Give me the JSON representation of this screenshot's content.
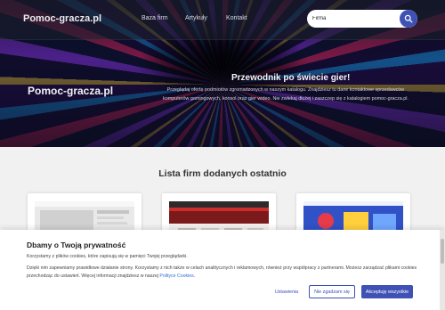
{
  "nav": {
    "brand": "Pomoc-gracza.pl",
    "links": [
      "Baza firm",
      "Artykuły",
      "Kontakt"
    ],
    "search": {
      "value": "Firma",
      "placeholder": "Firma"
    }
  },
  "hero": {
    "brand": "Pomoc-gracza.pl",
    "title": "Przewodnik po świecie gier!",
    "description": "Przeglądaj ofertę podmiotów zgromadzonych w naszym katalogu. Znajdziesz tu dane kontaktowe sprzedawców komputerów gamingowych, konsol oraz gier wideo. Nie zwlekaj dłużej i zaszczep się z katalogiem pomoc-gracza.pl."
  },
  "section": {
    "title": "Lista firm dodanych ostatnio",
    "cards": [
      {
        "name": "card-1"
      },
      {
        "name": "card-2"
      },
      {
        "name": "card-3"
      }
    ]
  },
  "cookie": {
    "title": "Dbamy o Twoją prywatność",
    "line1": "Korzystamy z plików cookies, które zapisują się w pamięci Twojej przeglądarki.",
    "line2": "Dzięki nim zapewniamy prawidłowe działanie strony. Korzystamy z nich także w celach analitycznych i reklamowych, również przy współpracy z partnerami. Możesz zarządzać plikami cookies przechodząc do ustawień. Więcej informacji znajdziesz w naszej ",
    "link": "Polityce Cookies",
    "line2_end": ".",
    "buttons": {
      "settings": "Ustawienia",
      "reject": "Nie zgadzam się",
      "accept": "Akceptuję wszystkie"
    }
  },
  "colors": {
    "accent": "#3f51b5",
    "link": "#2f6fd1"
  }
}
